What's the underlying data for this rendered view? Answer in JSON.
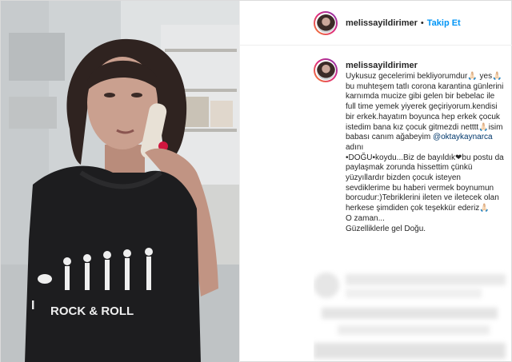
{
  "post": {
    "username": "melissayildirimer",
    "separator": "•",
    "follow_label": "Takip Et",
    "caption": {
      "username": "melissayildirimer",
      "text_before": "Uykusuz gecelerimi bekliyorumdur🙏🏻 yes🙏🏻bu muhteşem tatlı corona karantina günlerini karnımda mucize gibi gelen bir bebelac ile full time yemek yiyerek geçiriyorum.kendisi bir erkek.hayatım boyunca hep erkek çocuk istedim bana kız çocuk gitmezdi netttt🙏🏻isim babası canım ağabeyim ",
      "mention": "@oktaykaynarca",
      "text_after": " adını\n•DOĞU•koydu...Biz de bayıldık❤bu postu da paylaşmak zorunda hissettim çünkü yüzyıllardır bizden çocuk isteyen sevdiklerime bu haberi vermek boynumun borcudur:)Tebriklerini ileten ve iletecek olan herkese şimdiden çok teşekkür ederiz🙏🏻\nO zaman...\nGüzelliklerle gel Doğu."
    },
    "photo": {
      "shirt_text": "ROCK & ROLL",
      "shirt_prefix": "I"
    },
    "colors": {
      "link": "#0095f6",
      "mention": "#00376b",
      "border": "#dbdbdb"
    }
  }
}
